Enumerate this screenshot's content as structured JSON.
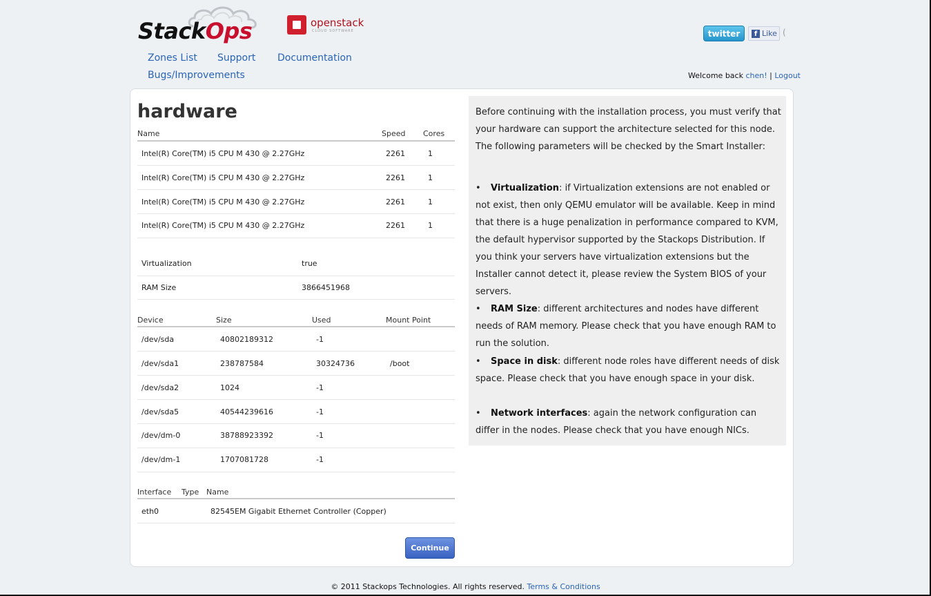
{
  "brand": {
    "logo_stack": "Stack",
    "logo_ops": "Ops",
    "openstack": "openstack",
    "openstack_sub": "CLOUD SOFTWARE"
  },
  "nav": {
    "zones": "Zones List",
    "support": "Support",
    "docs": "Documentation",
    "bugs": "Bugs/Improvements"
  },
  "social": {
    "twitter": "twitter",
    "fb_like": "Like",
    "fb_count": "("
  },
  "welcome": {
    "prefix": "Welcome back ",
    "user": "chen!",
    "sep": " | ",
    "logout": "Logout"
  },
  "hardware": {
    "title": "hardware",
    "cpu_headers": {
      "name": "Name",
      "speed": "Speed",
      "cores": "Cores"
    },
    "cpus": [
      {
        "name": "Intel(R) Core(TM) i5 CPU M 430 @ 2.27GHz",
        "speed": "2261",
        "cores": "1"
      },
      {
        "name": "Intel(R) Core(TM) i5 CPU M 430 @ 2.27GHz",
        "speed": "2261",
        "cores": "1"
      },
      {
        "name": "Intel(R) Core(TM) i5 CPU M 430 @ 2.27GHz",
        "speed": "2261",
        "cores": "1"
      },
      {
        "name": "Intel(R) Core(TM) i5 CPU M 430 @ 2.27GHz",
        "speed": "2261",
        "cores": "1"
      }
    ],
    "props": [
      {
        "label": "Virtualization",
        "value": "true"
      },
      {
        "label": "RAM Size",
        "value": "3866451968"
      }
    ],
    "disk_headers": {
      "device": "Device",
      "size": "Size",
      "used": "Used",
      "mount": "Mount Point"
    },
    "disks": [
      {
        "device": "/dev/sda",
        "size": "40802189312",
        "used": "-1",
        "mount": ""
      },
      {
        "device": "/dev/sda1",
        "size": "238787584",
        "used": "30324736",
        "mount": "/boot"
      },
      {
        "device": "/dev/sda2",
        "size": "1024",
        "used": "-1",
        "mount": ""
      },
      {
        "device": "/dev/sda5",
        "size": "40544239616",
        "used": "-1",
        "mount": ""
      },
      {
        "device": "/dev/dm-0",
        "size": "38788923392",
        "used": "-1",
        "mount": ""
      },
      {
        "device": "/dev/dm-1",
        "size": "1707081728",
        "used": "-1",
        "mount": ""
      }
    ],
    "nic_headers": {
      "iface": "Interface",
      "type": "Type",
      "name": "Name"
    },
    "nics": [
      {
        "iface": "eth0",
        "type": "",
        "name": "82545EM Gigabit Ethernet Controller (Copper)"
      }
    ],
    "continue": "Continue"
  },
  "info": {
    "intro": "Before continuing with the installation process, you must verify that your hardware can support the architecture selected for this node. The following parameters will be checked by the Smart Installer:",
    "items": [
      {
        "term": "Virtualization",
        "text": ": if Virtualization extensions are not enabled or not exist, then only QEMU emulator will be available. Keep in mind that there is a huge penalization in performance compared to KVM, the default hypervisor supported by the Stackops Distribution. If you think your servers have virtualization extensions but the Installer cannot detect it, please review the System BIOS of your servers."
      },
      {
        "term": "RAM Size",
        "text": ": different architectures and nodes have different needs of RAM memory. Please check that you have enough RAM to run the solution."
      },
      {
        "term": "Space in disk",
        "text": ": different node roles have different needs of disk space. Please check that you have enough space in your disk."
      },
      {
        "term": "Network interfaces",
        "text": ": again the network configuration can differ in the nodes. Please check that you have enough NICs."
      }
    ]
  },
  "footer": {
    "text": "© 2011 Stackops Technologies. All rights reserved. ",
    "link": "Terms & Conditions"
  }
}
